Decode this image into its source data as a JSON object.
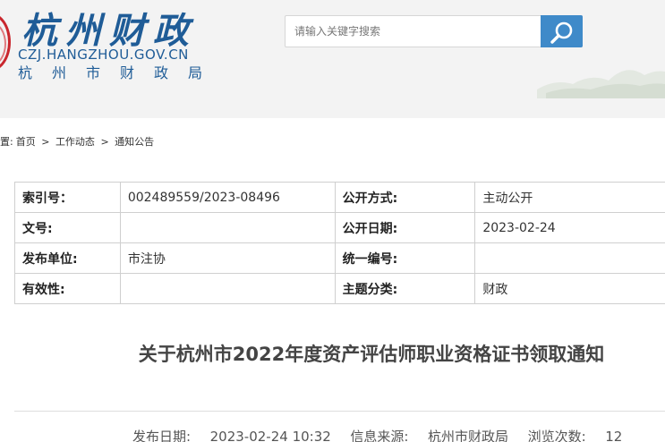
{
  "header": {
    "logo_title": "杭州财政",
    "logo_domain": "CZJ.HANGZHOU.GOV.CN",
    "logo_org": "杭州市财政局",
    "search_placeholder": "请输入关键字搜索",
    "search_icon": "magnifier-icon"
  },
  "breadcrumb": {
    "prefix": "置:",
    "items": [
      "首页",
      "工作动态",
      "通知公告"
    ],
    "separator": ">"
  },
  "info": {
    "index_label": "索引号：",
    "index_value": "002489559/2023-08496",
    "open_mode_label": "公开方式:",
    "open_mode_value": "主动公开",
    "doc_no_label": "文号:",
    "doc_no_value": "",
    "open_date_label": "公开日期:",
    "open_date_value": "2023-02-24",
    "issuer_label": "发布单位:",
    "issuer_value": "市注协",
    "unified_no_label": "统一编号:",
    "unified_no_value": "",
    "validity_label": "有效性:",
    "validity_value": "",
    "topic_label": "主题分类:",
    "topic_value": "财政"
  },
  "article": {
    "title": "关于杭州市2022年度资产评估师职业资格证书领取通知",
    "publish_label": "发布日期:",
    "publish_value": "2023-02-24 10:32",
    "source_label": "信息来源:",
    "source_value": "杭州市财政局",
    "views_label": "浏览次数:",
    "views_value": "12"
  },
  "colors": {
    "brand_blue": "#1f5c97",
    "search_button": "#3f8ac9",
    "emblem_red": "#c9262d"
  }
}
